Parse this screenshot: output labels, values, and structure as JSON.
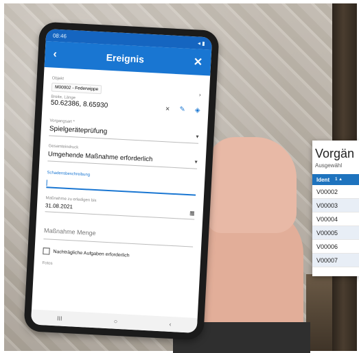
{
  "phone": {
    "status": {
      "time": "08:46",
      "right": "◂ ▮"
    },
    "appbar": {
      "back_icon": "‹",
      "title": "Ereignis",
      "close_icon": "✕"
    },
    "objekt": {
      "label": "Objekt",
      "value": "M00002 - Federwippe",
      "chevron": "›"
    },
    "coords": {
      "label": "Breite, Länge",
      "value": "50.62386, 8.65930",
      "clear_icon": "✕",
      "edit_icon": "✎",
      "locate_icon": "◈"
    },
    "vorgangsart": {
      "label": "Vorgangsart *",
      "value": "Spielgeräteprüfung",
      "arrow": "▾"
    },
    "gesamteindruck": {
      "label": "Gesamteindruck",
      "value": "Umgehende Maßnahme erforderlich",
      "arrow": "▾"
    },
    "schaden": {
      "label": "Schadensbeschreibung"
    },
    "massnahme_bis": {
      "label": "Maßnahme zu erledigen bis",
      "value": "31.08.2021",
      "calendar_icon": "▦"
    },
    "massnahme_menge": {
      "placeholder": "Maßnahme Menge"
    },
    "nachtraeglich": {
      "label": "Nachträgliche Aufgaben erforderlich"
    },
    "fotos": {
      "label": "Fotos"
    },
    "nav": {
      "recent": "III",
      "home": "○",
      "back": "‹"
    }
  },
  "panel": {
    "title": "Vorgän",
    "subtitle": "Ausgewähl",
    "header": {
      "ident": "Ident",
      "sort_icon": "1 ▲"
    },
    "rows": [
      "V00002",
      "V00003",
      "V00004",
      "V00005",
      "V00006",
      "V00007"
    ]
  }
}
